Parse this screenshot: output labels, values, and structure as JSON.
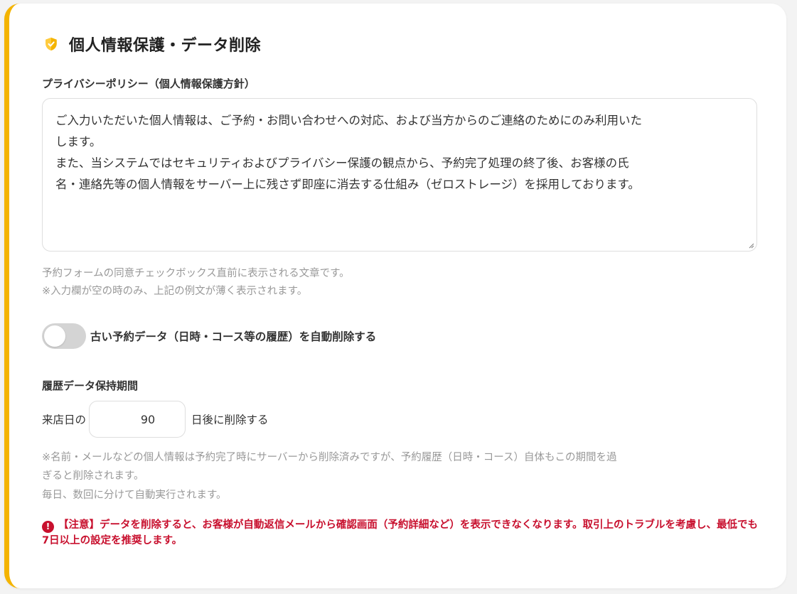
{
  "section": {
    "title": "個人情報保護・データ削除",
    "icon": "shield-icon",
    "accent_color": "#f4b400"
  },
  "privacy_policy": {
    "label": "プライバシーポリシー（個人情報保護方針）",
    "text_line1": "ご入力いただいた個人情報は、ご予約・お問い合わせへの対応、および当方からのご連絡のためにのみ利用いた",
    "text_line2": "します。",
    "text_line3": "また、当システムではセキュリティおよびプライバシー保護の観点から、予約完了処理の終了後、お客様の氏",
    "text_line4": "名・連絡先等の個人情報をサーバー上に残さず即座に消去する仕組み（ゼロストレージ）を採用しております。",
    "hint_line1": "予約フォームの同意チェックボックス直前に表示される文章です。",
    "hint_line2": "※入力欄が空の時のみ、上記の例文が薄く表示されます。"
  },
  "auto_delete": {
    "label": "古い予約データ（日時・コース等の履歴）を自動削除する",
    "enabled": false
  },
  "retention": {
    "label": "履歴データ保持期間",
    "prefix": "来店日の",
    "days": "90",
    "suffix": "日後に削除する",
    "note_line1": "※名前・メールなどの個人情報は予約完了時にサーバーから削除済みですが、予約履歴（日時・コース）自体もこの期間を過",
    "note_line2": "ぎると削除されます。",
    "note_line3": "毎日、数回に分けて自動実行されます。"
  },
  "warning": {
    "icon": "exclamation-icon",
    "color": "#c8102e",
    "text": "【注意】データを削除すると、お客様が自動返信メールから確認画面（予約詳細など）を表示できなくなります。取引上のトラブルを考慮し、最低でも7日以上の設定を推奨します。"
  }
}
